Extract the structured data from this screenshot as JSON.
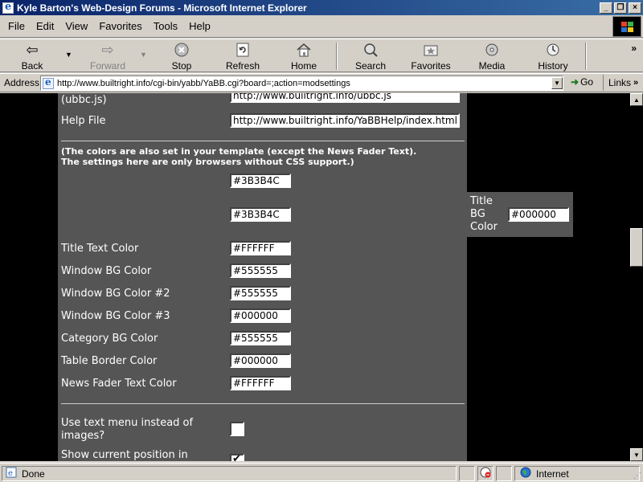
{
  "window": {
    "title": "Kyle Barton's Web-Design Forums - Microsoft Internet Explorer",
    "minimize": "_",
    "maximize": "❐",
    "close": "×"
  },
  "menu": [
    "File",
    "Edit",
    "View",
    "Favorites",
    "Tools",
    "Help"
  ],
  "toolbar": {
    "back": "Back",
    "forward": "Forward",
    "stop": "Stop",
    "refresh": "Refresh",
    "home": "Home",
    "search": "Search",
    "favorites": "Favorites",
    "media": "Media",
    "history": "History",
    "more": "»"
  },
  "address": {
    "label": "Address",
    "url": "http://www.builtright.info/cgi-bin/yabb/YaBB.cgi?board=;action=modsettings",
    "go": "Go",
    "links": "Links",
    "links_more": "»"
  },
  "settings": {
    "ubbc_label": "(ubbc.js)",
    "ubbc_value": "http://www.builtright.info/ubbc.js",
    "help_label": "Help File",
    "help_value": "http://www.builtright.info/YaBBHelp/index.html",
    "colors_note_1": "(The colors are also set in your template (except the News Fader Text).",
    "colors_note_2": "The settings here are only browsers without CSS support.)",
    "color_1": "#3B3B4C",
    "color_2": "#3B3B4C",
    "title_bg_label": "Title BG Color",
    "title_bg_value": "#000000",
    "title_text_label": "Title Text Color",
    "title_text_value": "#FFFFFF",
    "window_bg_label": "Window BG Color",
    "window_bg_value": "#555555",
    "window_bg2_label": "Window BG Color #2",
    "window_bg2_value": "#555555",
    "window_bg3_label": "Window BG Color #3",
    "window_bg3_value": "#000000",
    "category_bg_label": "Category BG Color",
    "category_bg_value": "#555555",
    "table_border_label": "Table Border Color",
    "table_border_value": "#000000",
    "news_fader_label": "News Fader Text Color",
    "news_fader_value": "#FFFFFF",
    "text_menu_label_1": "Use text menu instead of",
    "text_menu_label_2": "images?",
    "show_position_label": "Show current position in",
    "text_menu_checked": false,
    "show_position_checked": true
  },
  "status": {
    "text": "Done",
    "zone": "Internet"
  },
  "colors": {
    "panel_bg": "#555555",
    "page_bg": "#000000",
    "titlebar_start": "#0a246a",
    "titlebar_end": "#3a6ea5"
  }
}
